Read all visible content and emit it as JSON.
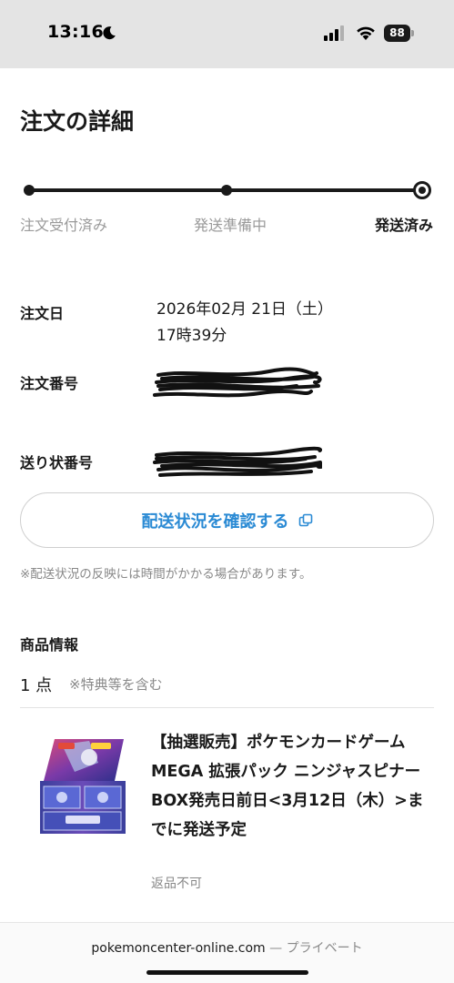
{
  "status_bar": {
    "time": "13:16",
    "battery": "88",
    "icons": [
      "moon-icon",
      "signal-icon",
      "wifi-icon",
      "battery-icon"
    ]
  },
  "page": {
    "title": "注文の詳細"
  },
  "progress": {
    "steps": [
      "注文受付済み",
      "発送準備中",
      "発送済み"
    ],
    "current_step": "発送済み",
    "completed_fraction": 1.0
  },
  "order": {
    "date_label": "注文日",
    "date_value_line1": "2026年02月 21日（土）",
    "date_value_line2": "17時39分",
    "number_label": "注文番号",
    "number_value": "",
    "tracking_label": "送り状番号",
    "tracking_value": ""
  },
  "tracking_button": {
    "label": "配送状況を確認する",
    "icon": "external-link-icon"
  },
  "note": "※配送状況の反映には時間がかかる場合があります。",
  "product_section": {
    "title": "商品情報",
    "quantity": "1 点",
    "quantity_note": "※特典等を含む",
    "item": {
      "name": "【抽選販売】ポケモンカードゲーム MEGA 拡張パック ニンジャスピナー BOX発売日前日<3月12日（木）>までに発送予定",
      "return_policy": "返品不可"
    }
  },
  "browser_bar": {
    "domain": "pokemoncenter-online.com",
    "separator": " — ",
    "mode": "プライベート"
  },
  "colors": {
    "accent": "#2a8ad4",
    "status_bar_bg": "#e4e4e4",
    "text": "#1a1a1a",
    "muted": "#888888"
  }
}
